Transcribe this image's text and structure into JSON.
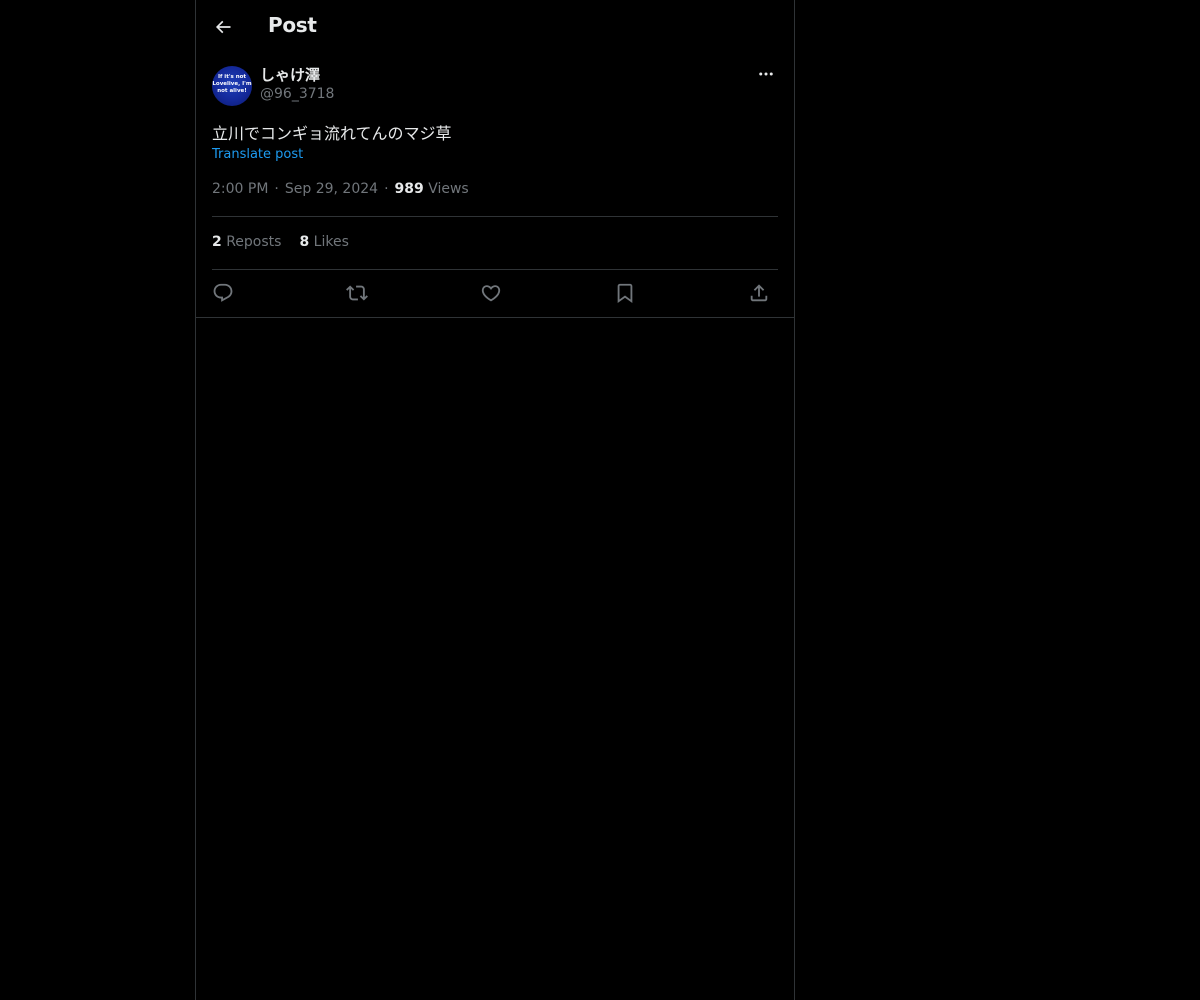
{
  "header": {
    "back_icon": "arrow-left-icon",
    "title": "Post"
  },
  "post": {
    "author": {
      "display_name": "しゃけ澤",
      "handle": "@96_3718",
      "avatar_text": "If it's not Lovelive, I'm not alive!",
      "avatar_color": "#14299a"
    },
    "more_icon": "ellipsis-icon",
    "text": "立川でコンギョ流れてんのマジ草",
    "translate_label": "Translate post",
    "time": "2:00 PM",
    "separator": "·",
    "date": "Sep 29, 2024",
    "views_count": "989",
    "views_label": "Views",
    "reposts_count": "2",
    "reposts_label": "Reposts",
    "likes_count": "8",
    "likes_label": "Likes"
  },
  "actions": [
    {
      "icon": "reply-icon"
    },
    {
      "icon": "repost-icon"
    },
    {
      "icon": "like-icon"
    },
    {
      "icon": "bookmark-icon"
    },
    {
      "icon": "share-icon"
    }
  ],
  "colors": {
    "background": "#000000",
    "text_primary": "#e7e9ea",
    "text_secondary": "#71767b",
    "link": "#1d9bf0",
    "border": "#2f3336"
  }
}
